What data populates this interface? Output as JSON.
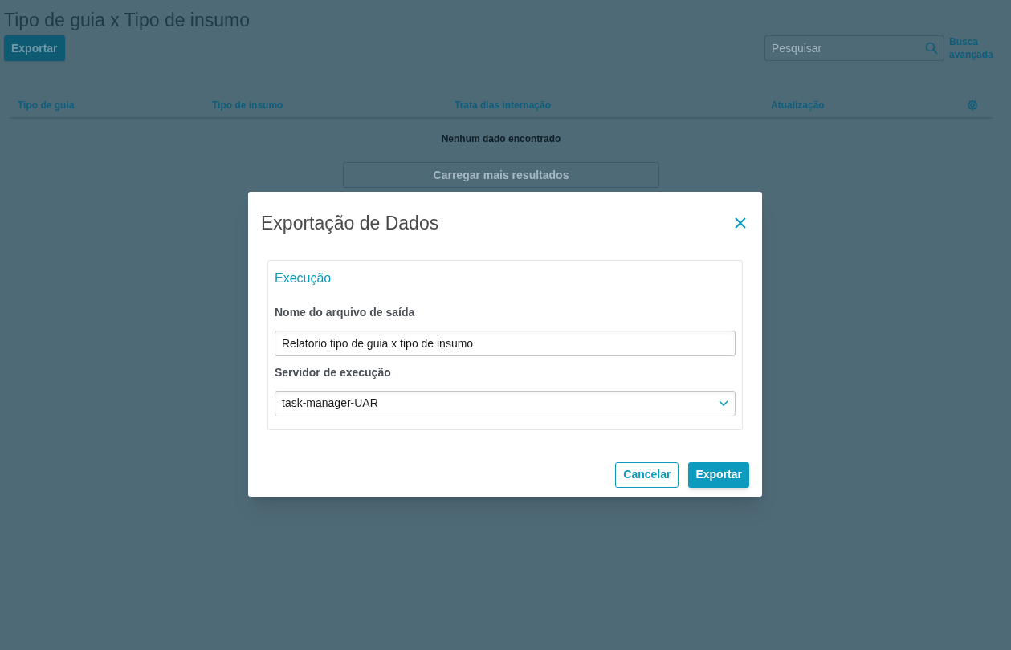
{
  "page": {
    "title": "Tipo de guia x Tipo de insumo",
    "export_button": "Exportar",
    "search": {
      "placeholder": "Pesquisar"
    },
    "advanced_search": "Busca avançada"
  },
  "table": {
    "columns": [
      "Tipo de guia",
      "Tipo de insumo",
      "Trata dias internação",
      "Atualização"
    ],
    "empty_message": "Nenhum dado encontrado",
    "load_more": "Carregar mais resultados"
  },
  "dialog": {
    "title": "Exportação de Dados",
    "section": "Execução",
    "fields": [
      {
        "kind": "text",
        "label": "Nome do arquivo de saída",
        "value": "Relatorio tipo de guia x tipo de insumo"
      },
      {
        "kind": "select",
        "label": "Servidor de execução",
        "value": "task-manager-UAR"
      }
    ],
    "buttons": [
      {
        "kind": "secondary",
        "label": "Cancelar"
      },
      {
        "kind": "primary",
        "label": "Exportar"
      }
    ]
  }
}
